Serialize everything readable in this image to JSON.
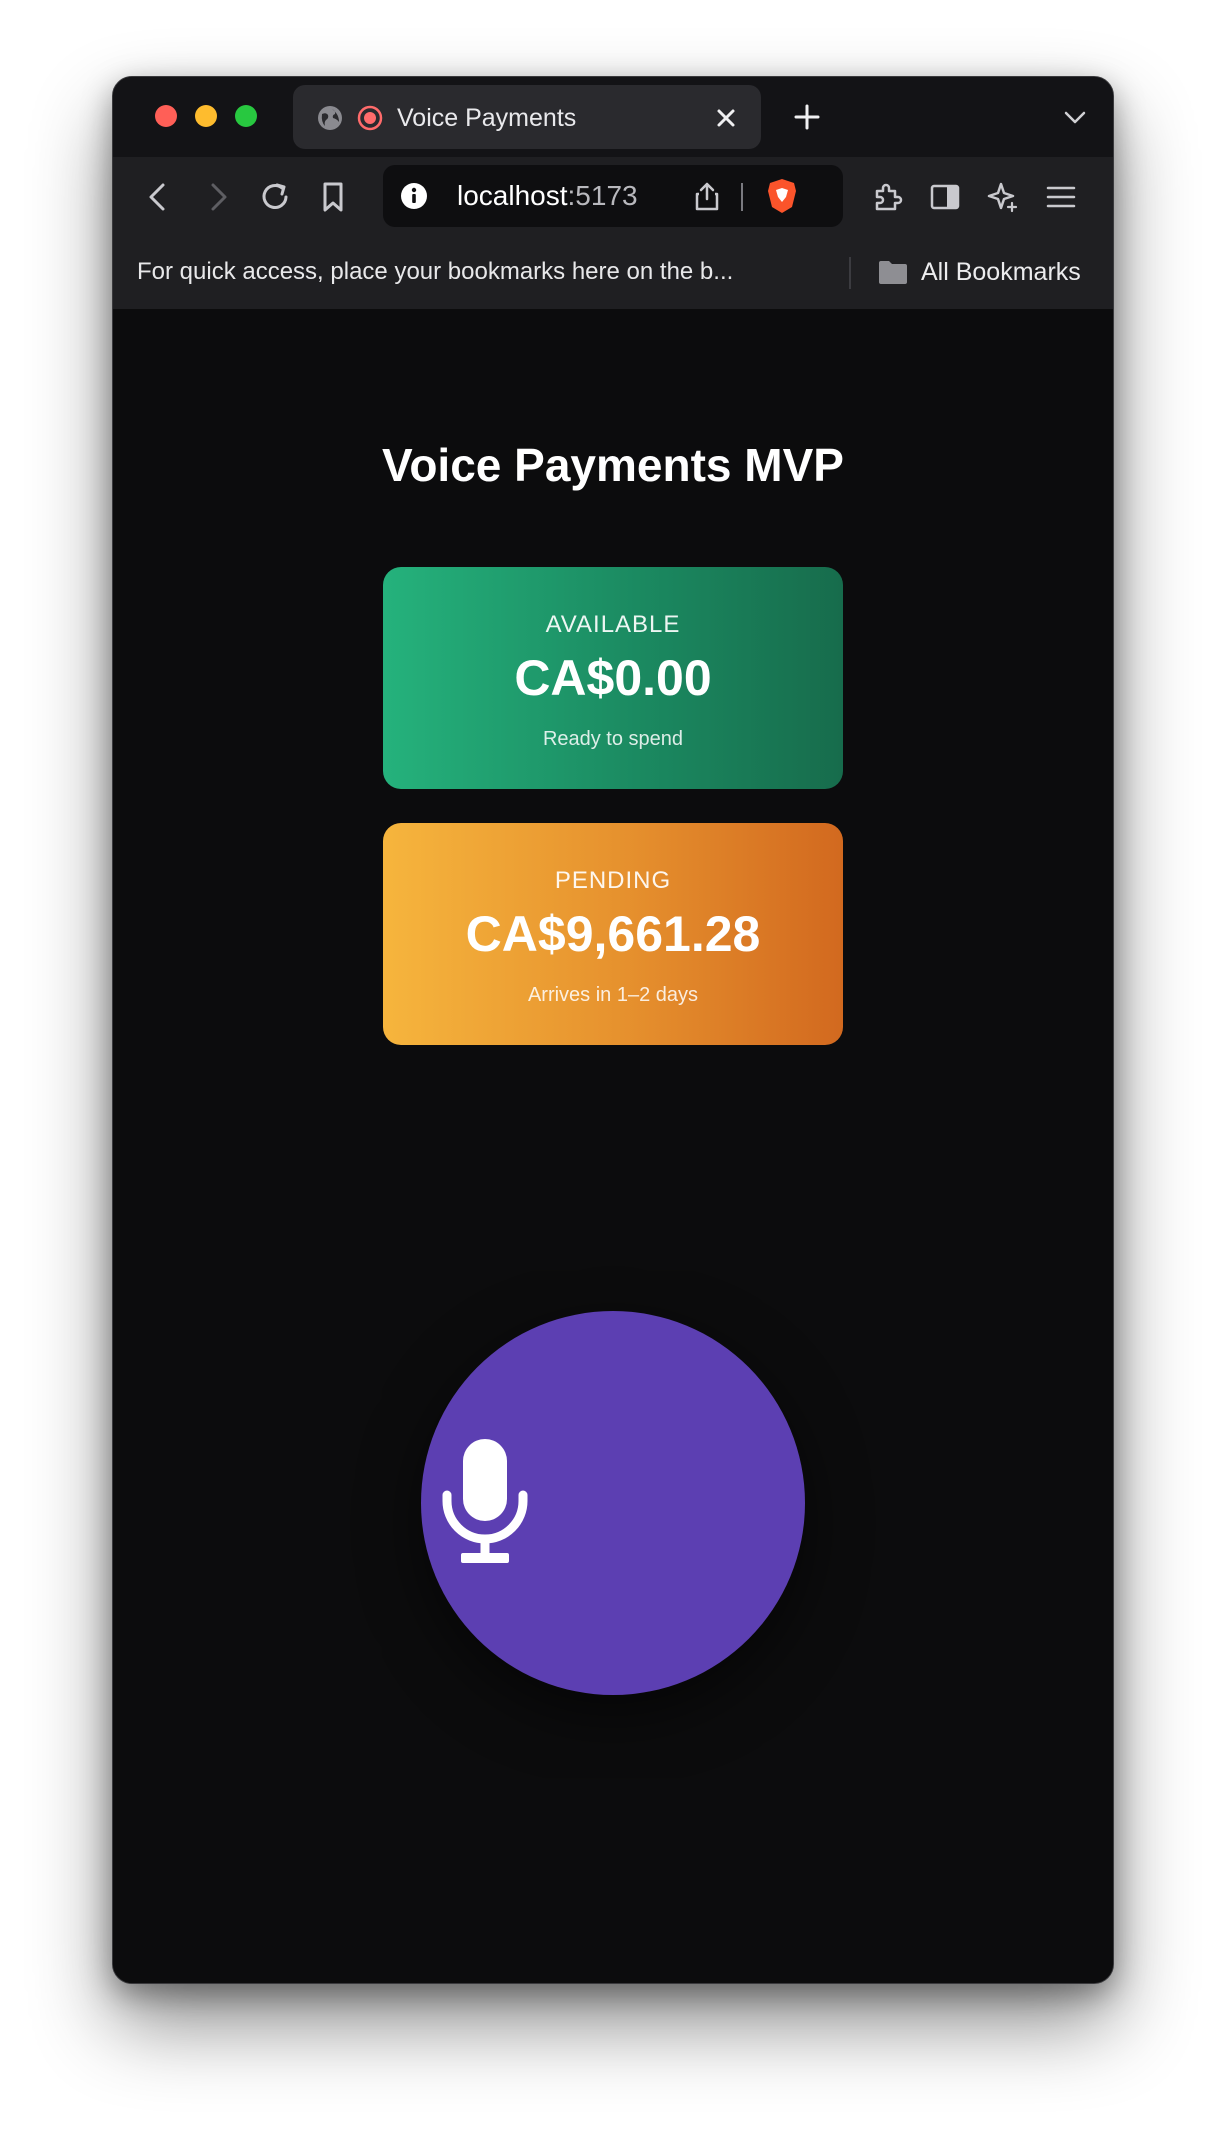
{
  "browser": {
    "tab": {
      "title": "Voice Payments"
    },
    "address_bar": {
      "host": "localhost",
      "port": ":5173"
    },
    "bookmarks_bar": {
      "hint": "For quick access, place your bookmarks here on the b...",
      "all_bookmarks_label": "All Bookmarks"
    }
  },
  "app": {
    "title": "Voice Payments MVP",
    "balances": [
      {
        "label": "AVAILABLE",
        "amount": "CA$0.00",
        "caption": "Ready to spend",
        "color": "#1f9e6f"
      },
      {
        "label": "PENDING",
        "amount": "CA$9,661.28",
        "caption": "Arrives in 1–2 days",
        "color": "#e88a2c"
      }
    ],
    "voice_button": {
      "icon": "microphone-icon",
      "color": "#5c3fb2"
    }
  }
}
